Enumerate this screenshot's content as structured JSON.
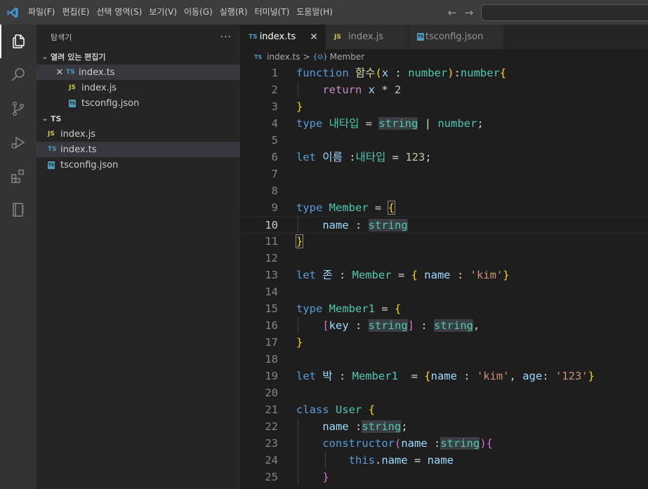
{
  "menu": [
    "파일(F)",
    "편집(E)",
    "선택 영역(S)",
    "보기(V)",
    "이동(G)",
    "실행(R)",
    "터미널(T)",
    "도움말(H)"
  ],
  "nav": {
    "back": "←",
    "forward": "→"
  },
  "sidebar": {
    "title": "탐색기",
    "more": "···",
    "open_editors": {
      "label": "열려 있는 편집기",
      "files": [
        {
          "icon": "TS",
          "name": "index.ts"
        },
        {
          "icon": "JS",
          "name": "index.js"
        },
        {
          "icon": "TS",
          "name": "tsconfig.json"
        }
      ]
    },
    "folder": {
      "label": "TS",
      "files": [
        {
          "icon": "JS",
          "name": "index.js"
        },
        {
          "icon": "TS",
          "name": "index.ts"
        },
        {
          "icon": "TS",
          "name": "tsconfig.json"
        }
      ]
    }
  },
  "tabs": [
    {
      "icon": "TS",
      "name": "index.ts"
    },
    {
      "icon": "JS",
      "name": "index.js"
    },
    {
      "icon": "TS",
      "name": "tsconfig.json"
    }
  ],
  "tab_close": "✕",
  "breadcrumb": {
    "file": "index.ts",
    "sep": ">",
    "symbol": "Member"
  },
  "editor": {
    "current_line": 10,
    "line_numbers": [
      "1",
      "2",
      "3",
      "4",
      "5",
      "6",
      "7",
      "8",
      "9",
      "10",
      "11",
      "12",
      "13",
      "14",
      "15",
      "16",
      "17",
      "18",
      "19",
      "20",
      "21",
      "22",
      "23",
      "24",
      "25"
    ],
    "lines": [
      [
        [
          "kw",
          "function"
        ],
        [
          "pn",
          " "
        ],
        [
          "fn",
          "함수"
        ],
        [
          "b1",
          "("
        ],
        [
          "vr",
          "x"
        ],
        [
          "pn",
          " : "
        ],
        [
          "ty",
          "number"
        ],
        [
          "b1",
          ")"
        ],
        [
          "pn",
          ":"
        ],
        [
          "ty",
          "number"
        ],
        [
          "b1",
          "{"
        ]
      ],
      [
        [
          "pn",
          "    "
        ],
        [
          "ctl",
          "return"
        ],
        [
          "pn",
          " "
        ],
        [
          "vr",
          "x"
        ],
        [
          "pn",
          " * "
        ],
        [
          "num",
          "2"
        ]
      ],
      [
        [
          "b1",
          "}"
        ]
      ],
      [
        [
          "kw",
          "type"
        ],
        [
          "pn",
          " "
        ],
        [
          "ty",
          "내타입"
        ],
        [
          "pn",
          " = "
        ],
        [
          "ty hl",
          "string"
        ],
        [
          "pn",
          " | "
        ],
        [
          "ty",
          "number"
        ],
        [
          "pn",
          ";"
        ]
      ],
      [],
      [
        [
          "kw",
          "let"
        ],
        [
          "pn",
          " "
        ],
        [
          "vr",
          "이름"
        ],
        [
          "pn",
          " :"
        ],
        [
          "ty",
          "내타입"
        ],
        [
          "pn",
          " = "
        ],
        [
          "num",
          "123"
        ],
        [
          "pn",
          ";"
        ]
      ],
      [],
      [],
      [
        [
          "kw",
          "type"
        ],
        [
          "pn",
          " "
        ],
        [
          "ty",
          "Member"
        ],
        [
          "pn",
          " = "
        ],
        [
          "b1 bm",
          "{"
        ]
      ],
      [
        [
          "pn",
          "    "
        ],
        [
          "vr",
          "name"
        ],
        [
          "pn",
          " : "
        ],
        [
          "ty hl",
          "string"
        ]
      ],
      [
        [
          "b1 bm",
          "}"
        ]
      ],
      [],
      [
        [
          "kw",
          "let"
        ],
        [
          "pn",
          " "
        ],
        [
          "vr",
          "존"
        ],
        [
          "pn",
          " : "
        ],
        [
          "ty",
          "Member"
        ],
        [
          "pn",
          " = "
        ],
        [
          "b1",
          "{"
        ],
        [
          "pn",
          " "
        ],
        [
          "vr",
          "name"
        ],
        [
          "pn",
          " : "
        ],
        [
          "str",
          "'kim'"
        ],
        [
          "b1",
          "}"
        ]
      ],
      [],
      [
        [
          "kw",
          "type"
        ],
        [
          "pn",
          " "
        ],
        [
          "ty",
          "Member1"
        ],
        [
          "pn",
          " = "
        ],
        [
          "b1",
          "{"
        ]
      ],
      [
        [
          "pn",
          "    "
        ],
        [
          "b2",
          "["
        ],
        [
          "vr",
          "key"
        ],
        [
          "pn",
          " : "
        ],
        [
          "ty hl",
          "string"
        ],
        [
          "b2",
          "]"
        ],
        [
          "pn",
          " : "
        ],
        [
          "ty hl",
          "string"
        ],
        [
          "pn",
          ","
        ]
      ],
      [
        [
          "b1",
          "}"
        ]
      ],
      [],
      [
        [
          "kw",
          "let"
        ],
        [
          "pn",
          " "
        ],
        [
          "vr",
          "박"
        ],
        [
          "pn",
          " : "
        ],
        [
          "ty",
          "Member1"
        ],
        [
          "pn",
          "  = "
        ],
        [
          "b1",
          "{"
        ],
        [
          "vr",
          "name"
        ],
        [
          "pn",
          " : "
        ],
        [
          "str",
          "'kim'"
        ],
        [
          "pn",
          ", "
        ],
        [
          "vr",
          "age"
        ],
        [
          "pn",
          ": "
        ],
        [
          "str",
          "'123'"
        ],
        [
          "b1",
          "}"
        ]
      ],
      [],
      [
        [
          "kw",
          "class"
        ],
        [
          "pn",
          " "
        ],
        [
          "ty",
          "User"
        ],
        [
          "pn",
          " "
        ],
        [
          "b1",
          "{"
        ]
      ],
      [
        [
          "pn",
          "    "
        ],
        [
          "vr",
          "name"
        ],
        [
          "pn",
          " :"
        ],
        [
          "ty hl",
          "string"
        ],
        [
          "pn",
          ";"
        ]
      ],
      [
        [
          "pn",
          "    "
        ],
        [
          "kw",
          "constructor"
        ],
        [
          "b2",
          "("
        ],
        [
          "vr",
          "name"
        ],
        [
          "pn",
          " :"
        ],
        [
          "ty hl",
          "string"
        ],
        [
          "b2",
          ")"
        ],
        [
          "b2",
          "{"
        ]
      ],
      [
        [
          "pn",
          "        "
        ],
        [
          "kw",
          "this"
        ],
        [
          "pn",
          "."
        ],
        [
          "vr",
          "name"
        ],
        [
          "pn",
          " = "
        ],
        [
          "vr",
          "name"
        ]
      ],
      [
        [
          "pn",
          "    "
        ],
        [
          "b2",
          "}"
        ]
      ]
    ]
  }
}
